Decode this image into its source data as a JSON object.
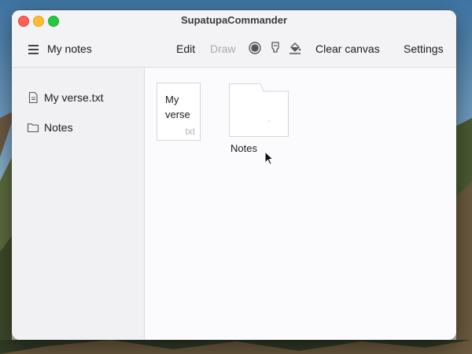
{
  "window": {
    "title": "SupatupaCommander"
  },
  "toolbar": {
    "menu_label": "My notes",
    "edit_label": "Edit",
    "draw_label": "Draw",
    "clear_label": "Clear canvas",
    "settings_label": "Settings",
    "icons": [
      "record-icon",
      "marker-icon",
      "fill-bucket-icon",
      "hamburger-icon"
    ]
  },
  "sidebar": {
    "items": [
      {
        "label": "My verse.txt",
        "icon": "document-icon"
      },
      {
        "label": "Notes",
        "icon": "folder-icon"
      }
    ]
  },
  "main": {
    "file": {
      "name": "My verse",
      "ext": "txt"
    },
    "folder": {
      "name": "Notes"
    }
  },
  "colors": {
    "close": "#fe5f57",
    "minimize": "#febc2e",
    "zoom": "#28c840"
  }
}
